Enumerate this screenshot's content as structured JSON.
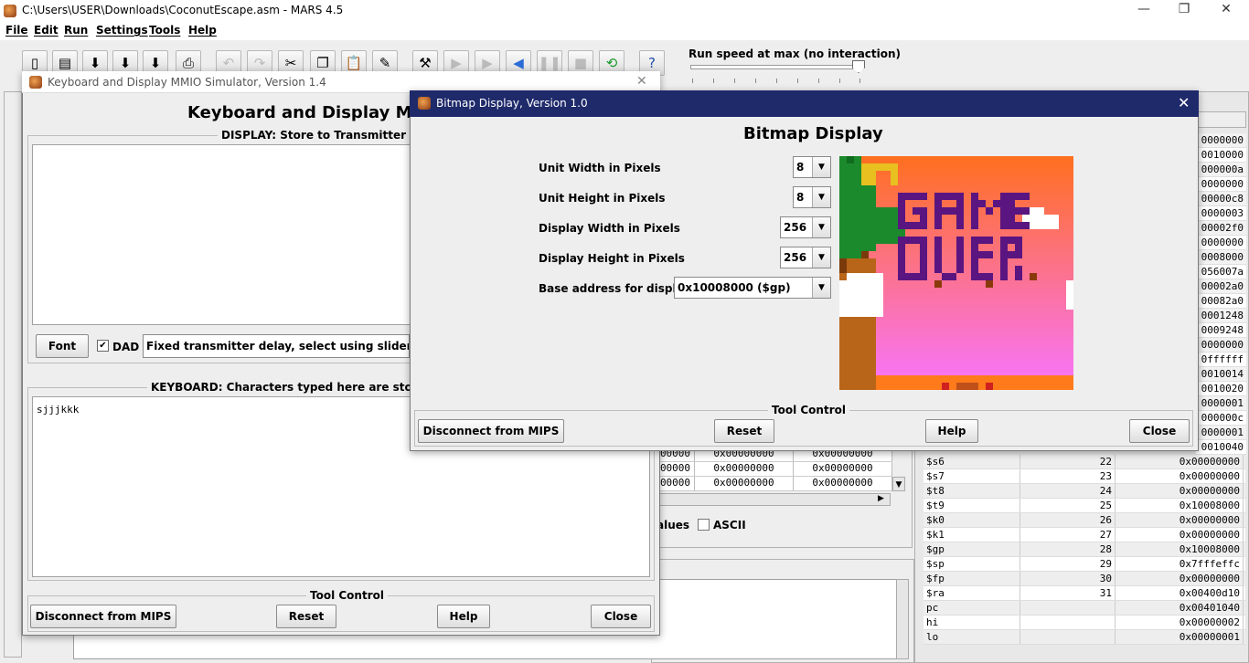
{
  "main_window": {
    "title": "C:\\Users\\USER\\Downloads\\CoconutEscape.asm  -  MARS 4.5",
    "minimize": "—",
    "maximize": "❐",
    "close": "✕"
  },
  "menubar": [
    "File",
    "Edit",
    "Run",
    "Settings",
    "Tools",
    "Help"
  ],
  "toolbar": {
    "icons": [
      "new-file",
      "open",
      "save",
      "save-as",
      "dump",
      "print",
      "undo",
      "redo",
      "cut",
      "copy",
      "paste",
      "find-replace",
      "assemble",
      "run",
      "step",
      "backstep",
      "pause",
      "stop",
      "reset",
      "help"
    ],
    "speed_label": "Run speed at max (no interaction)"
  },
  "kbd_mmio": {
    "title": "Keyboard and Display MMIO Simulator, Version 1.4",
    "close": "✕",
    "heading": "Keyboard and Display MMIO",
    "display_legend": "DISPLAY: Store to Transmitter Data (",
    "display_text": "",
    "font_button": "Font",
    "dad_checked": "✔",
    "dad_label": "DAD",
    "delay_text": "Fixed transmitter delay, select using slider",
    "keyboard_legend": "KEYBOARD: Characters typed here are stored to R",
    "keyboard_text": "sjjjkkk",
    "tool_control_legend": "Tool Control",
    "disconnect_button": "Disconnect from MIPS",
    "reset_button": "Reset",
    "help_button": "Help",
    "close_button": "Close"
  },
  "bitmap": {
    "title": "Bitmap Display, Version 1.0",
    "close": "✕",
    "heading": "Bitmap Display",
    "unit_width_label": "Unit Width in Pixels",
    "unit_width_value": "8",
    "unit_height_label": "Unit Height in Pixels",
    "unit_height_value": "8",
    "display_width_label": "Display Width in Pixels",
    "display_width_value": "256",
    "display_height_label": "Display Height in Pixels",
    "display_height_value": "256",
    "base_address_label": "Base address for display",
    "base_address_value": "0x10008000 ($gp)",
    "tool_control_legend": "Tool Control",
    "disconnect_button": "Disconnect from MIPS",
    "reset_button": "Reset",
    "help_button": "Help",
    "close_button": "Close",
    "canvas_colors": {
      "sky_top": "#ff6f1f",
      "sky_bottom": "#f875ff",
      "text": "#5a1580",
      "leaves": "#1b8a2c",
      "trunk": "#b8651a",
      "ground": "#ff7a1a",
      "cloud": "#ffffff"
    }
  },
  "data_segment": {
    "rows": [
      [
        "00000",
        "0x00000000",
        "0x00000000"
      ],
      [
        "00000",
        "0x00000000",
        "0x00000000"
      ],
      [
        "00000",
        "0x00000000",
        "0x00000000"
      ]
    ],
    "values_label": "alues",
    "ascii_label": "ASCII"
  },
  "registers_partial_values": [
    "0000000",
    "0010000",
    "000000a",
    "0000000",
    "00000c8",
    "0000003",
    "00002f0",
    "0000000",
    "0008000",
    "056007a",
    "00002a0",
    "00082a0",
    "0001248",
    "0009248",
    "0000000",
    "0ffffff",
    "0010014",
    "0010020",
    "0000001",
    "000000c",
    "0000001",
    "0010040"
  ],
  "registers": [
    {
      "name": "$s6",
      "num": "22",
      "value": "0x00000000"
    },
    {
      "name": "$s7",
      "num": "23",
      "value": "0x00000000"
    },
    {
      "name": "$t8",
      "num": "24",
      "value": "0x00000000"
    },
    {
      "name": "$t9",
      "num": "25",
      "value": "0x10008000"
    },
    {
      "name": "$k0",
      "num": "26",
      "value": "0x00000000"
    },
    {
      "name": "$k1",
      "num": "27",
      "value": "0x00000000"
    },
    {
      "name": "$gp",
      "num": "28",
      "value": "0x10008000"
    },
    {
      "name": "$sp",
      "num": "29",
      "value": "0x7fffeffc"
    },
    {
      "name": "$fp",
      "num": "30",
      "value": "0x00000000"
    },
    {
      "name": "$ra",
      "num": "31",
      "value": "0x00400d10"
    },
    {
      "name": "pc",
      "num": "",
      "value": "0x00401040"
    },
    {
      "name": "hi",
      "num": "",
      "value": "0x00000002"
    },
    {
      "name": "lo",
      "num": "",
      "value": "0x00000001"
    }
  ]
}
